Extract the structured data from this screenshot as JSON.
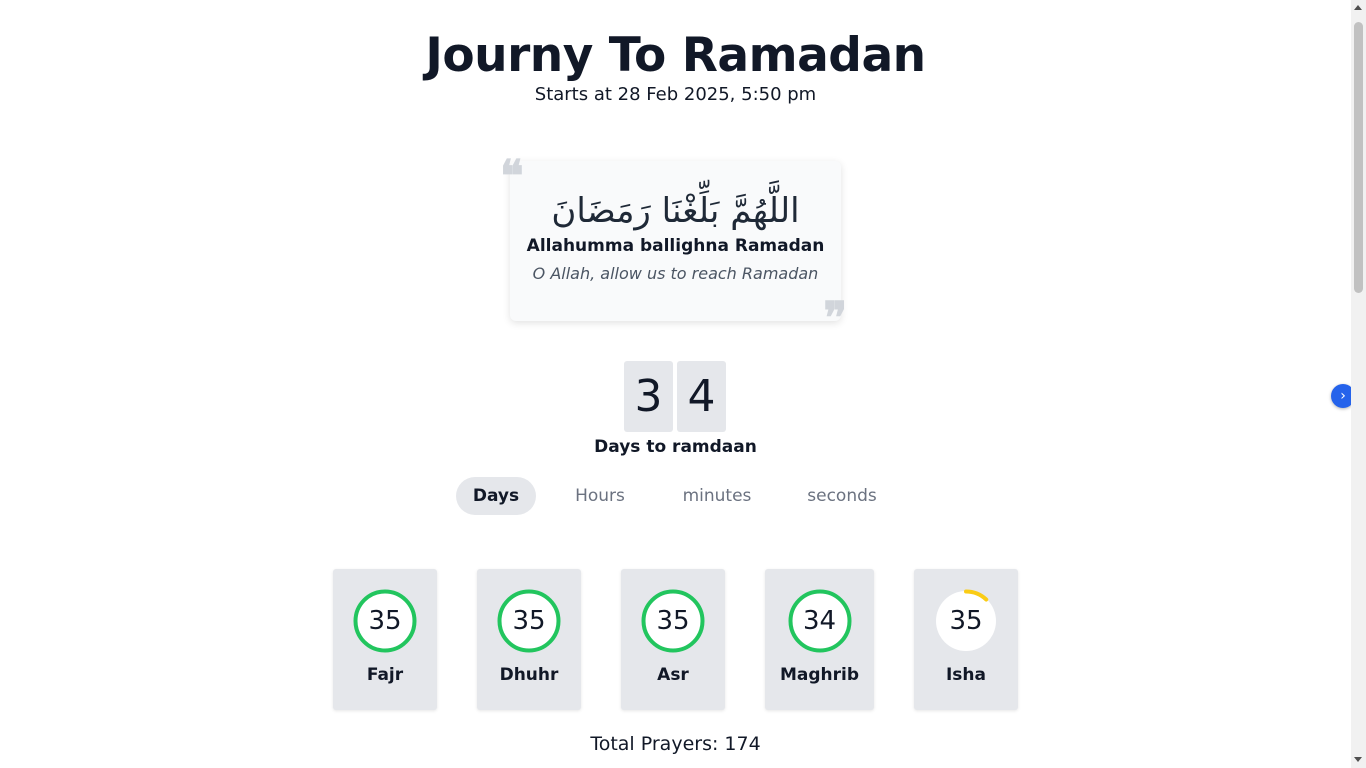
{
  "header": {
    "title": "Journy To Ramadan",
    "subtitle": "Starts at 28 Feb 2025, 5:50 pm"
  },
  "dua": {
    "arabic": "اللَّهُمَّ بَلِّغْنَا رَمَضَانَ",
    "transliteration": "Allahumma ballighna Ramadan",
    "translation": "O Allah, allow us to reach Ramadan",
    "open_quote_icon": "quote-open-icon",
    "close_quote_icon": "quote-close-icon"
  },
  "countdown": {
    "digits": [
      "3",
      "4"
    ],
    "label": "Days to ramdaan"
  },
  "tabs": [
    {
      "label": "Days",
      "active": true
    },
    {
      "label": "Hours",
      "active": false
    },
    {
      "label": "minutes",
      "active": false
    },
    {
      "label": "seconds",
      "active": false
    }
  ],
  "prayers": [
    {
      "name": "Fajr",
      "count": "35",
      "progress": 1.0,
      "color": "#22c55e"
    },
    {
      "name": "Dhuhr",
      "count": "35",
      "progress": 1.0,
      "color": "#22c55e"
    },
    {
      "name": "Asr",
      "count": "35",
      "progress": 1.0,
      "color": "#22c55e"
    },
    {
      "name": "Maghrib",
      "count": "34",
      "progress": 1.0,
      "color": "#22c55e"
    },
    {
      "name": "Isha",
      "count": "35",
      "progress": 0.12,
      "color": "#facc15"
    }
  ],
  "total": "Total Prayers: 174",
  "side_toggle_icon": "chevron-right-icon",
  "colors": {
    "accent": "#2563eb",
    "complete": "#22c55e",
    "partial": "#facc15"
  }
}
